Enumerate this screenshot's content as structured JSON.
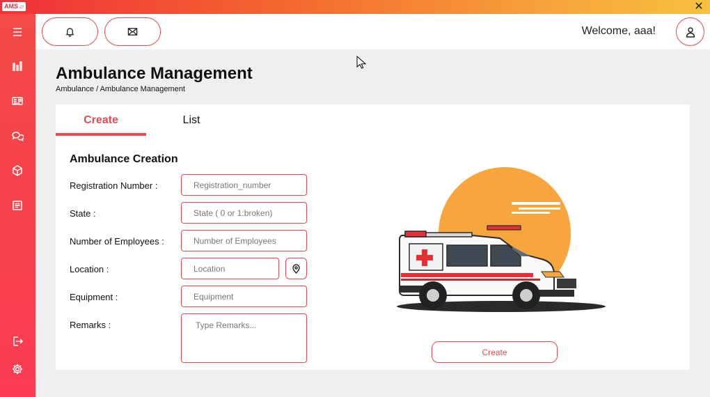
{
  "app": {
    "logo_text": "AMS",
    "close_symbol": "✕"
  },
  "colors": {
    "accent": "#e84a4e",
    "sidebar": "#f8404c",
    "titlebar_start": "#f0303a",
    "titlebar_end": "#f7c23f"
  },
  "sidebar": {
    "items": [
      {
        "icon": "hamburger-menu-icon"
      },
      {
        "icon": "bar-chart-icon"
      },
      {
        "icon": "id-card-icon"
      },
      {
        "icon": "chat-bubbles-icon"
      },
      {
        "icon": "cube-icon"
      },
      {
        "icon": "document-icon"
      }
    ],
    "bottom": [
      {
        "icon": "logout-icon"
      },
      {
        "icon": "settings-gear-icon"
      }
    ]
  },
  "header": {
    "notification_icon": "bell-icon",
    "mail_icon": "envelope-icon",
    "welcome": "Welcome, aaa!",
    "avatar_icon": "user-icon"
  },
  "page": {
    "title": "Ambulance Management",
    "breadcrumb": "Ambulance / Ambulance Management"
  },
  "tabs": [
    {
      "label": "Create",
      "active": true
    },
    {
      "label": "List",
      "active": false
    }
  ],
  "form": {
    "title": "Ambulance Creation",
    "fields": {
      "registration": {
        "label": "Registration Number :",
        "placeholder": "Registration_number",
        "value": ""
      },
      "state": {
        "label": "State :",
        "placeholder": "State ( 0 or 1:broken)",
        "value": ""
      },
      "employees": {
        "label": "Number of Employees :",
        "placeholder": "Number of Employees",
        "value": ""
      },
      "location": {
        "label": "Location :",
        "placeholder": "Location",
        "value": ""
      },
      "equipment": {
        "label": "Equipment :",
        "placeholder": "Equipment",
        "value": ""
      },
      "remarks": {
        "label": "Remarks :",
        "placeholder": "Type Remarks...",
        "value": ""
      }
    },
    "location_button_icon": "map-pin-icon",
    "submit_label": "Create"
  }
}
